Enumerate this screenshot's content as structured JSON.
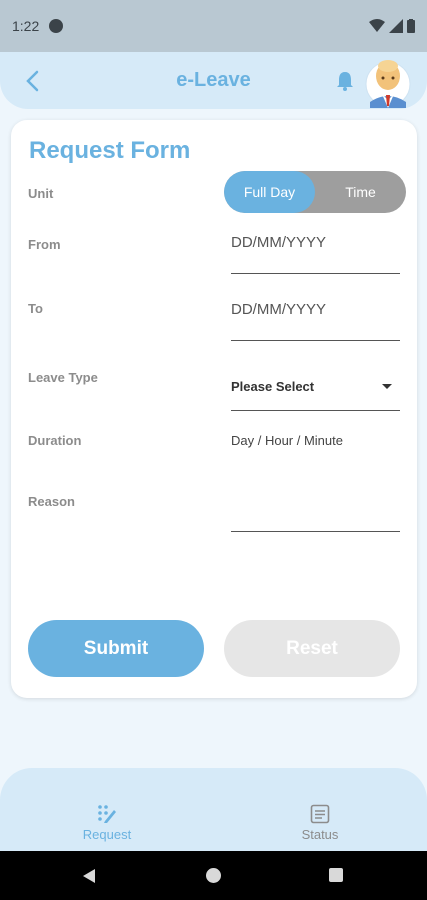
{
  "status_bar": {
    "time": "1:22"
  },
  "header": {
    "title": "e-Leave"
  },
  "form": {
    "title": "Request Form",
    "unit_label": "Unit",
    "unit_options": [
      "Full Day",
      "Time"
    ],
    "from_label": "From",
    "from_placeholder": "DD/MM/YYYY",
    "to_label": "To",
    "to_placeholder": "DD/MM/YYYY",
    "leave_type_label": "Leave Type",
    "leave_type_value": "Please Select",
    "duration_label": "Duration",
    "duration_value": "Day / Hour / Minute",
    "reason_label": "Reason",
    "reason_value": "",
    "submit_label": "Submit",
    "reset_label": "Reset"
  },
  "bottom_nav": {
    "items": [
      {
        "label": "Request",
        "icon": "request-icon",
        "active": true
      },
      {
        "label": "Status",
        "icon": "status-list-icon",
        "active": false
      }
    ]
  },
  "colors": {
    "accent": "#6ab2e0",
    "header_bg": "#d6eaf8",
    "toggle_inactive": "#9e9e9e",
    "reset_bg": "#e6e6e6"
  }
}
